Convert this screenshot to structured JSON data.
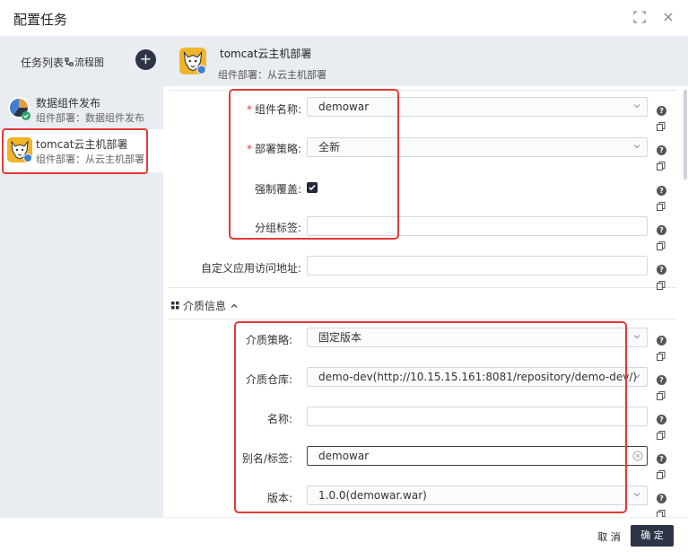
{
  "dialog": {
    "title": "配置任务"
  },
  "sidebar": {
    "list_label": "任务列表",
    "flow_label": "流程图",
    "add_label": "+",
    "items": [
      {
        "name": "数据组件发布",
        "sub": "组件部署：数据组件发布"
      },
      {
        "name": "tomcat云主机部署",
        "sub": "组件部署：从云主机部署"
      }
    ]
  },
  "component": {
    "name": "tomcat云主机部署",
    "sub": "组件部署：从云主机部署"
  },
  "form": {
    "component_name": {
      "label": "组件名称:",
      "value": "demowar",
      "required": "*"
    },
    "deploy_strategy": {
      "label": "部署策略:",
      "value": "全新",
      "required": "*"
    },
    "force_overwrite": {
      "label": "强制覆盖:"
    },
    "group_tag": {
      "label": "分组标签:",
      "value": ""
    },
    "custom_url": {
      "label": "自定义应用访问地址:",
      "value": ""
    }
  },
  "media": {
    "section_title": "介质信息",
    "strategy": {
      "label": "介质策略:",
      "value": "固定版本"
    },
    "repository": {
      "label": "介质仓库:",
      "value": "demo-dev(http://10.15.15.161:8081/repository/demo-dev/)"
    },
    "name": {
      "label": "名称:",
      "value": ""
    },
    "alias": {
      "label": "别名/标签:",
      "value": "demowar"
    },
    "version": {
      "label": "版本:",
      "value": "1.0.0(demowar.war)"
    }
  },
  "footer": {
    "cancel": "取 消",
    "ok": "确 定"
  },
  "help_glyph": "?",
  "colors": {
    "highlight": "#e53935",
    "primary_dark": "#2b3545",
    "sidebar_bg": "#e9ecf1"
  }
}
